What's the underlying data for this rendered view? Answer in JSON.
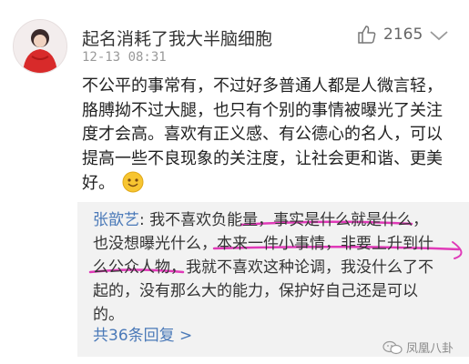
{
  "comment": {
    "username": "起名消耗了我大半脑细胞",
    "time": "12-13 08:31",
    "likes": "2165",
    "body_lines": [
      "不公平的事常有，不过好多普通人都是人微言轻，",
      "胳膊拗不过大腿，也只有个别的事情被曝光了关注",
      "度才会高。喜欢有正义感、有公德心的名人，可以",
      "提高一些不良现象的关注度，让社会更和谐、更美",
      "好。"
    ],
    "emoji": "smile-emoji"
  },
  "reply": {
    "name": "张歆艺",
    "colon": ": ",
    "line1_a": "我不喜欢负能量，",
    "line1_b": "事实是什么就是什么，",
    "line2_a": "也没想曝光什么，",
    "line2_b": "本来一件小事情，非要上升到什",
    "line3_a": "么公众人物，",
    "line3_b": "我就不喜欢这种论调，我没什么了不",
    "line4": "起的，没有那么大的能力，保护好自己还是可以",
    "line5": "的。",
    "see_more": "共36条回复 >"
  },
  "watermark": "凤凰八卦",
  "colors": {
    "link": "#4a79b8",
    "highlight": "#e03ab8",
    "reply_bg": "#f2f2f2"
  }
}
